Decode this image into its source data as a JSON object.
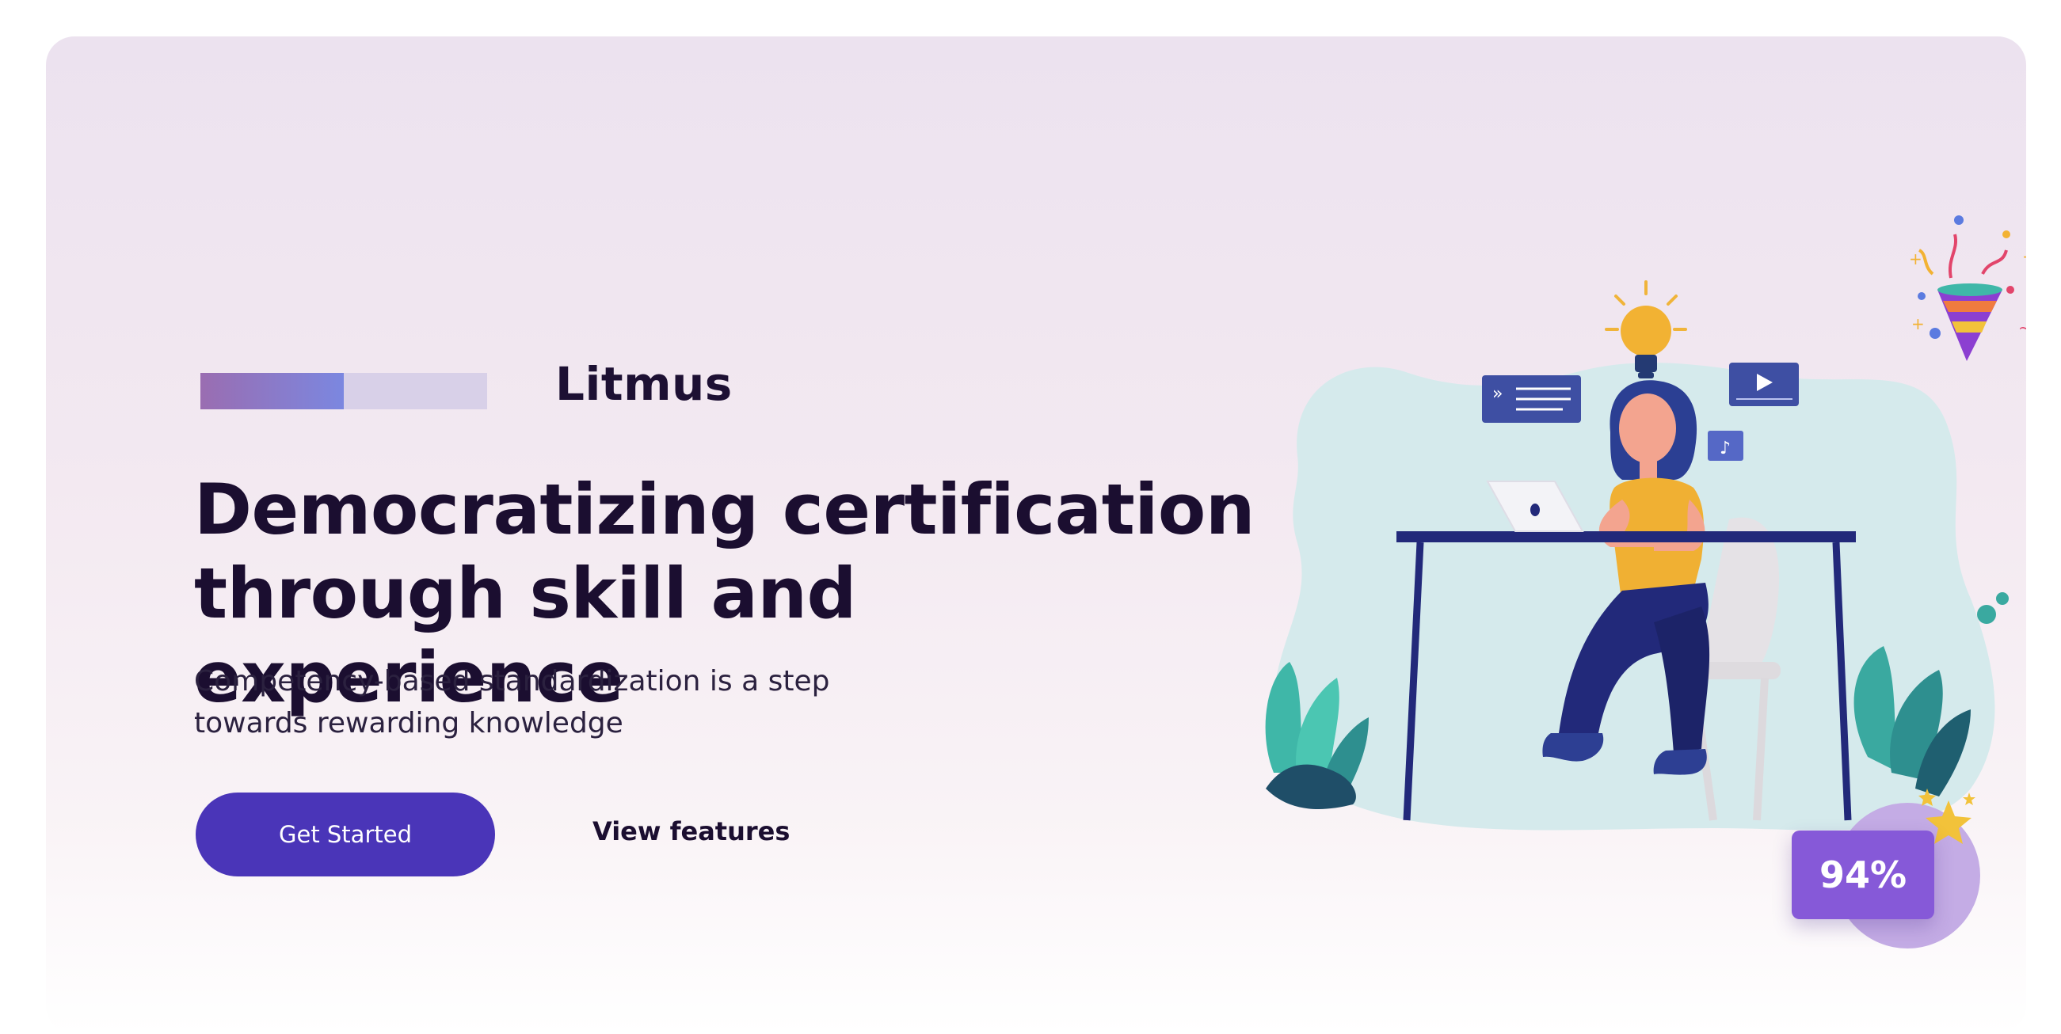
{
  "brand": {
    "name": "Litmus",
    "progress_fraction": 0.5
  },
  "hero": {
    "headline_line1": "Democratizing certification",
    "headline_line2": "through skill and experience",
    "subtitle_line1": "Competency-based standardization is a step",
    "subtitle_line2": "towards rewarding knowledge"
  },
  "actions": {
    "primary_label": "Get Started",
    "secondary_label": "View features"
  },
  "badge": {
    "score": "94%"
  },
  "colors": {
    "primary": "#4a35b8",
    "heading": "#1b0e30",
    "badge": "#8659d8",
    "progress_start": "#9a6db1",
    "progress_end": "#7b87e0"
  },
  "icons": [
    "lightbulb-icon",
    "chat-bubble-icon",
    "video-play-icon",
    "music-note-icon",
    "party-popper-icon",
    "star-icon"
  ]
}
